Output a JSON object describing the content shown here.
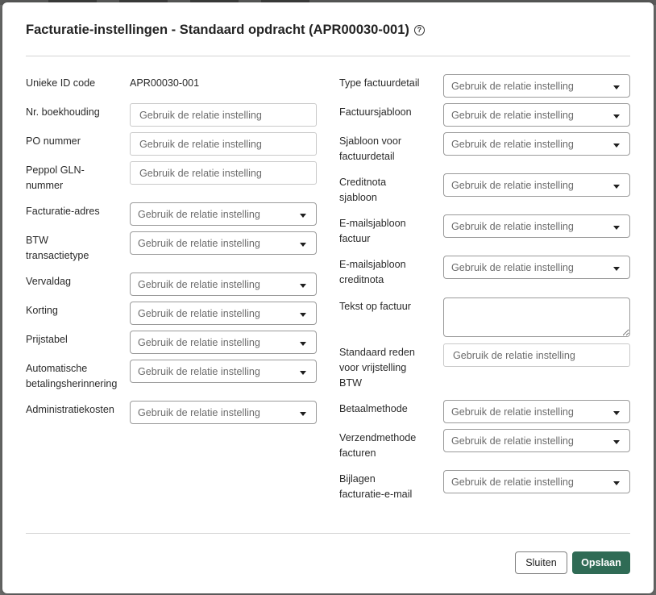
{
  "dialog": {
    "title": "Facturatie-instellingen - Standaard opdracht (APR00030-001)",
    "help_icon": "question-circle-icon"
  },
  "placeholder": "Gebruik de relatie instelling",
  "left": {
    "unique_id_label": "Unieke ID code",
    "unique_id_value": "APR00030-001",
    "bookkeeping_label": "Nr. boekhouding",
    "po_label": "PO nummer",
    "peppol_label_1": "Peppol GLN-",
    "peppol_label_2": "nummer",
    "address_label": "Facturatie-adres",
    "vat_type_label_1": "BTW",
    "vat_type_label_2": "transactietype",
    "due_day_label": "Vervaldag",
    "discount_label": "Korting",
    "price_table_label": "Prijstabel",
    "reminder_label_1": "Automatische",
    "reminder_label_2": "betalingsherinnering",
    "admin_costs_label": "Administratiekosten"
  },
  "right": {
    "detail_type_label": "Type factuurdetail",
    "invoice_template_label": "Factuursjabloon",
    "detail_template_label_1": "Sjabloon voor",
    "detail_template_label_2": "factuurdetail",
    "credit_template_label_1": "Creditnota",
    "credit_template_label_2": "sjabloon",
    "email_invoice_label_1": "E-mailsjabloon",
    "email_invoice_label_2": "factuur",
    "email_credit_label_1": "E-mailsjabloon",
    "email_credit_label_2": "creditnota",
    "invoice_text_label": "Tekst op factuur",
    "vat_exempt_label_1": "Standaard reden",
    "vat_exempt_label_2": "voor vrijstelling",
    "vat_exempt_label_3": "BTW",
    "payment_method_label": "Betaalmethode",
    "shipping_method_label_1": "Verzendmethode",
    "shipping_method_label_2": "facturen",
    "attachments_label_1": "Bijlagen",
    "attachments_label_2": "facturatie-e-mail"
  },
  "footer": {
    "close_label": "Sluiten",
    "save_label": "Opslaan"
  },
  "colors": {
    "primary": "#2f6b55",
    "overlay": "#6f706f"
  }
}
